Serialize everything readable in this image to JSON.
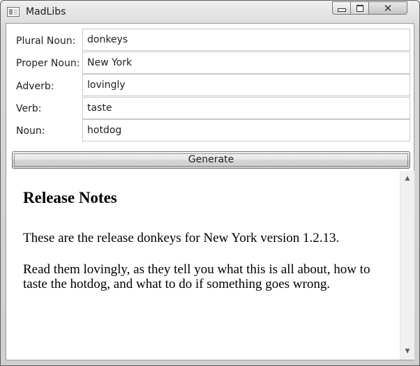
{
  "window": {
    "title": "MadLibs",
    "controls": {
      "minimize": "minimize",
      "maximize": "maximize",
      "close": "close"
    }
  },
  "form": {
    "fields": [
      {
        "label": "Plural Noun:",
        "value": "donkeys"
      },
      {
        "label": "Proper Noun:",
        "value": "New York"
      },
      {
        "label": "Adverb:",
        "value": "lovingly"
      },
      {
        "label": "Verb:",
        "value": "taste"
      },
      {
        "label": "Noun:",
        "value": "hotdog"
      }
    ],
    "generate_label": "Generate"
  },
  "document": {
    "heading": "Release Notes",
    "paragraph1": "These are the release donkeys for New York version 1.2.13.",
    "paragraph2": "Read them lovingly, as they tell you what this is all about, how to taste the hotdog, and what to do if something goes wrong."
  }
}
